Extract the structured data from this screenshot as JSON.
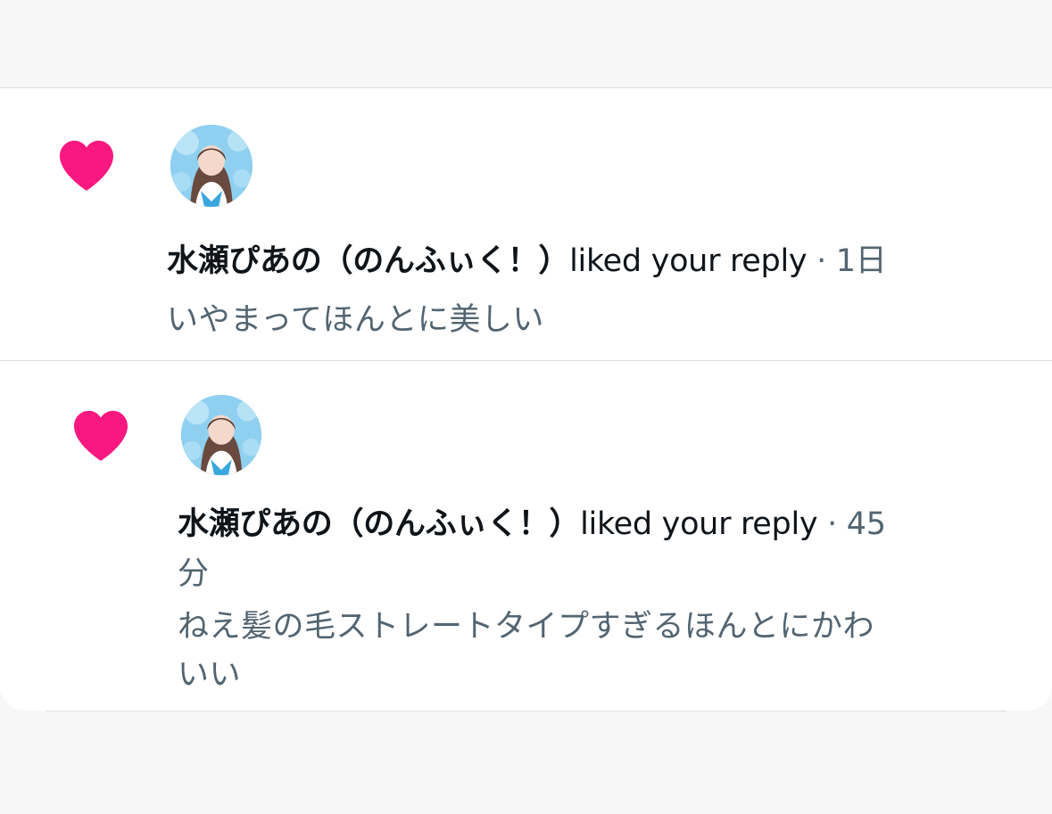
{
  "colors": {
    "heart": "#f91880",
    "text_primary": "#0f1419",
    "text_secondary": "#536471",
    "divider": "#dcdfe3"
  },
  "notifications": [
    {
      "icon": "heart-icon",
      "user_name": "水瀬ぴあの（のんふぃく！）",
      "action": "liked your reply",
      "separator": "·",
      "time": "1日",
      "reply_text": "いやまってほんとに美しい"
    },
    {
      "icon": "heart-icon",
      "user_name": "水瀬ぴあの（のんふぃく！）",
      "action": "liked your reply",
      "separator": "·",
      "time": "45",
      "time_unit": "分",
      "reply_text_line1": "ねえ髪の毛ストレートタイプすぎるほんとにかわ",
      "reply_text_line2": "いい"
    }
  ]
}
